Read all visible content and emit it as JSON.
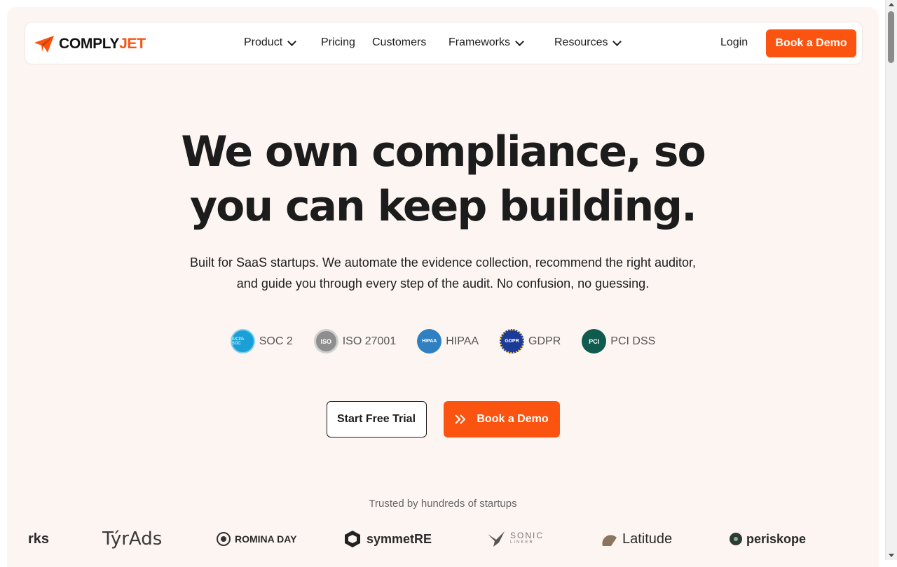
{
  "brand": {
    "name_main": "COMPLY",
    "name_accent": "JET",
    "accent_color": "#fb5410"
  },
  "nav": {
    "items": [
      {
        "label": "Product",
        "dropdown": true
      },
      {
        "label": "Pricing",
        "dropdown": false
      },
      {
        "label": "Customers",
        "dropdown": false
      },
      {
        "label": "Frameworks",
        "dropdown": true
      },
      {
        "label": "Resources",
        "dropdown": true
      }
    ],
    "login": "Login",
    "demo": "Book a Demo"
  },
  "hero": {
    "headline_line1": "We own compliance, so",
    "headline_line2": "you can keep building.",
    "sub_line1": "Built for SaaS startups. We automate the evidence collection, recommend the right auditor,",
    "sub_line2": "and guide you through every step of the audit. No confusion, no guessing."
  },
  "frameworks": [
    {
      "label": "SOC 2",
      "icon": "aicpa-soc-icon",
      "icon_text": "AICPA SOC"
    },
    {
      "label": "ISO 27001",
      "icon": "iso-icon",
      "icon_text": "ISO"
    },
    {
      "label": "HIPAA",
      "icon": "hipaa-icon",
      "icon_text": "HIPAA"
    },
    {
      "label": "GDPR",
      "icon": "gdpr-icon",
      "icon_text": "GDPR"
    },
    {
      "label": "PCI DSS",
      "icon": "pci-icon",
      "icon_text": "PCI"
    }
  ],
  "cta": {
    "trial": "Start Free Trial",
    "demo": "Book a Demo"
  },
  "trusted": {
    "caption": "Trusted by hundreds of startups",
    "logos": [
      {
        "name": "rks"
      },
      {
        "name": "TýrAds"
      },
      {
        "name": "ROMINA DAY"
      },
      {
        "name": "symmetRE"
      },
      {
        "name": "SONIC",
        "sub": "LINKER"
      },
      {
        "name": "Latitude"
      },
      {
        "name": "periskope"
      }
    ]
  }
}
